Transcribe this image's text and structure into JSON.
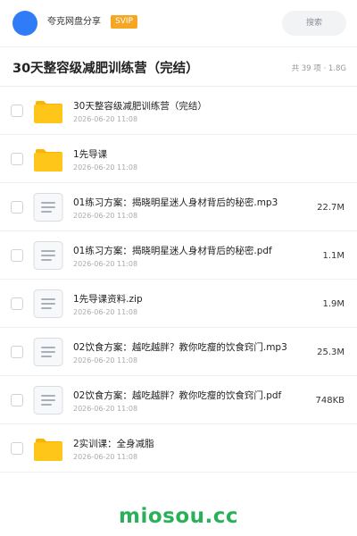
{
  "header": {
    "app_name": "夸克网盘分享",
    "badge": "SVIP",
    "search_label": "搜索"
  },
  "folder": {
    "title": "30天整容级减肥训练营（完结）",
    "meta": "共 39 项 · 1.8G"
  },
  "files": [
    {
      "type": "folder",
      "name": "30天整容级减肥训练营（完结）",
      "date": "2026-06-20 11:08",
      "size": ""
    },
    {
      "type": "folder",
      "name": "1先导课",
      "date": "2026-06-20 11:08",
      "size": ""
    },
    {
      "type": "doc",
      "name": "01练习方案：揭晓明星迷人身材背后的秘密.mp3",
      "date": "2026-06-20 11:08",
      "size": "22.7M"
    },
    {
      "type": "doc",
      "name": "01练习方案：揭晓明星迷人身材背后的秘密.pdf",
      "date": "2026-06-20 11:08",
      "size": "1.1M"
    },
    {
      "type": "doc",
      "name": "1先导课资料.zip",
      "date": "2026-06-20 11:08",
      "size": "1.9M"
    },
    {
      "type": "doc",
      "name": "02饮食方案：越吃越胖？教你吃瘦的饮食窍门.mp3",
      "date": "2026-06-20 11:08",
      "size": "25.3M"
    },
    {
      "type": "doc",
      "name": "02饮食方案：越吃越胖？教你吃瘦的饮食窍门.pdf",
      "date": "2026-06-20 11:08",
      "size": "748KB"
    },
    {
      "type": "folder",
      "name": "2实训课：全身减脂",
      "date": "2026-06-20 11:08",
      "size": ""
    }
  ],
  "watermark": "miosou.cc",
  "colors": {
    "avatar": "#2f7cf6",
    "badge": "#f5a623",
    "folder": "#ffc61a",
    "watermark": "#2bb05a"
  }
}
